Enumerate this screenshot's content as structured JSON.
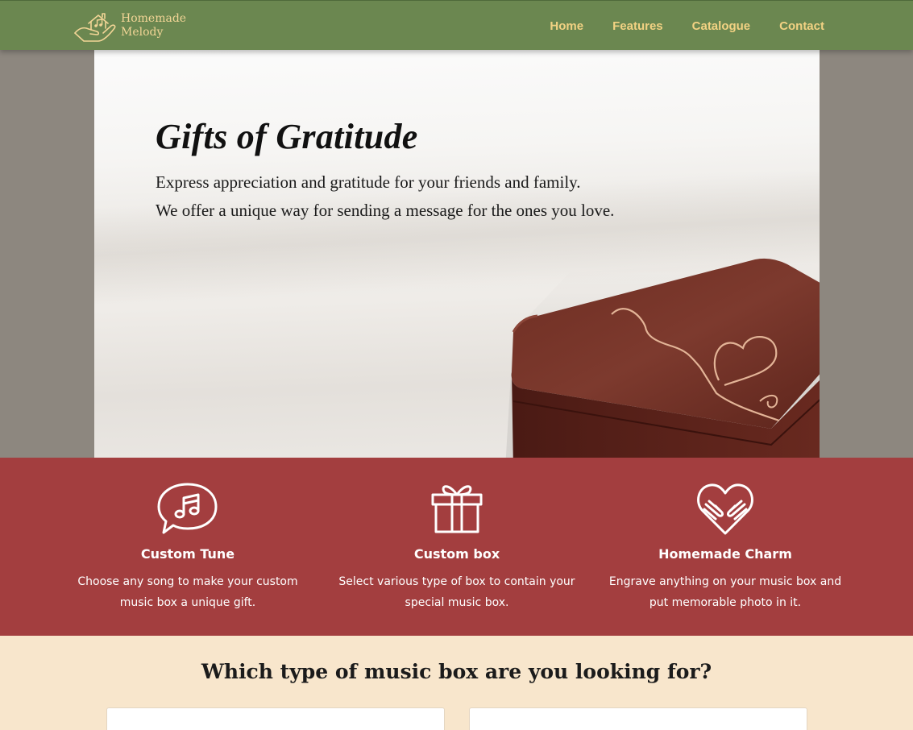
{
  "brand": {
    "line1": "Homemade",
    "line2": "Melody",
    "logo_icon": "house-hand-music-icon"
  },
  "nav": {
    "items": [
      {
        "label": "Home"
      },
      {
        "label": "Features"
      },
      {
        "label": "Catalogue"
      },
      {
        "label": "Contact"
      }
    ]
  },
  "hero": {
    "title": "Gifts of Gratitude",
    "line1": "Express appreciation and gratitude for your friends and family.",
    "line2": "We offer a unique way for sending a message for the ones you love.",
    "image": "wooden-music-box-heart-engraving"
  },
  "features": [
    {
      "icon": "music-chat-bubble-icon",
      "title": "Custom Tune",
      "description": "Choose any song to make your custom music box a unique gift."
    },
    {
      "icon": "gift-box-icon",
      "title": "Custom box",
      "description": "Select various type of box to contain your special music box."
    },
    {
      "icon": "heart-hands-icon",
      "title": "Homemade Charm",
      "description": "Engrave anything on your music box and put memorable photo in it."
    }
  ],
  "catalog": {
    "heading": "Which type of music box are you looking for?"
  },
  "colors": {
    "navbar": "#6b8750",
    "nav_text": "#f2d283",
    "features_bg": "#a33e3f",
    "catalog_bg": "#f8e6cc",
    "side_bg": "#8d877f"
  }
}
